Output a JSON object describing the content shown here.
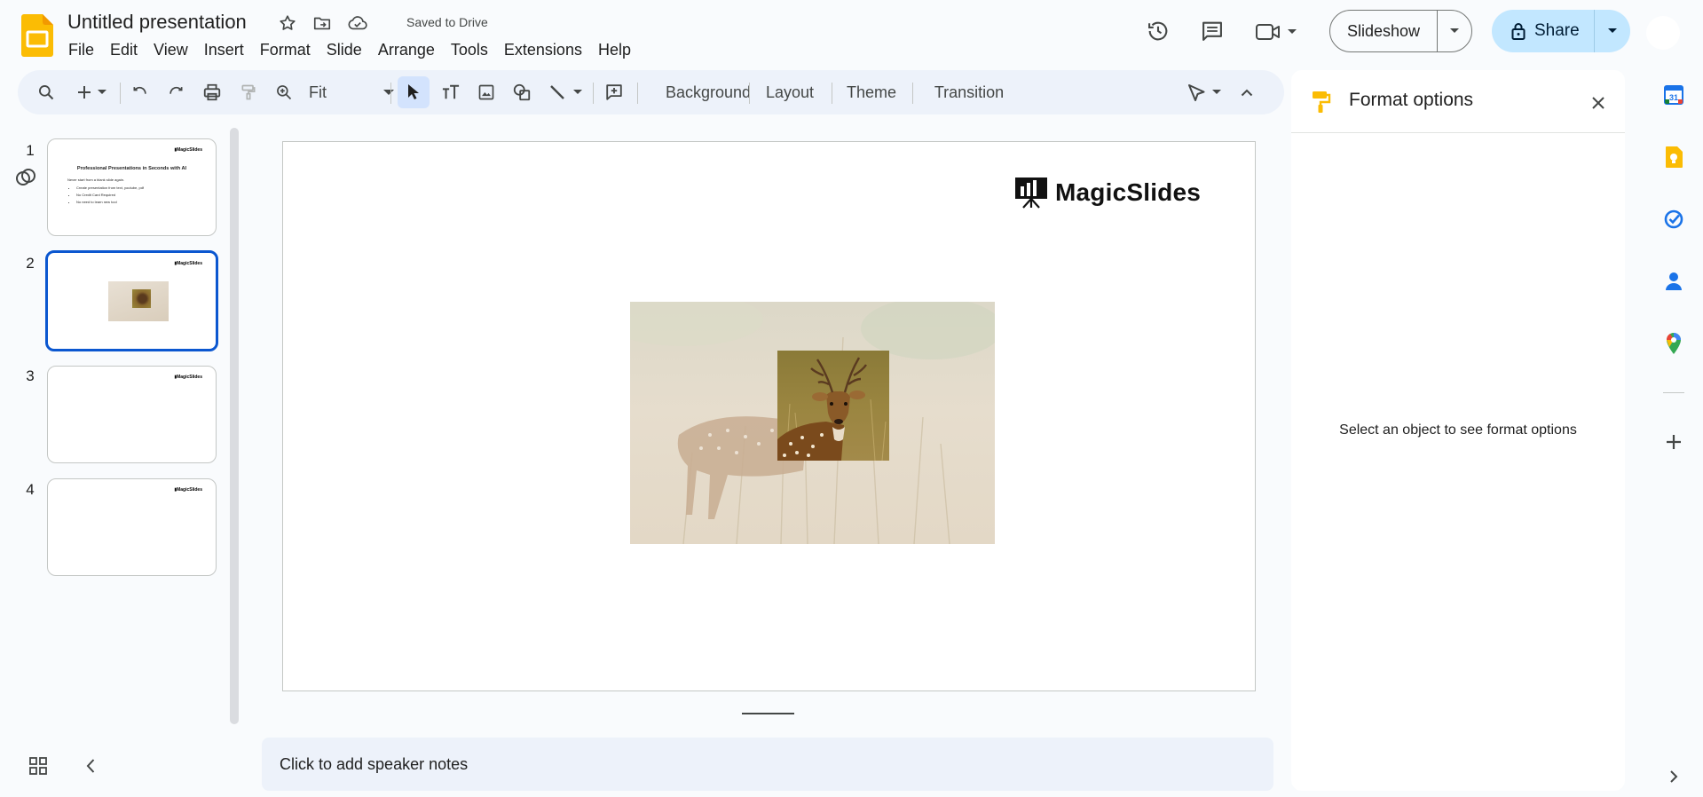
{
  "header": {
    "doc_title": "Untitled presentation",
    "save_status": "Saved to Drive",
    "menu": [
      "File",
      "Edit",
      "View",
      "Insert",
      "Format",
      "Slide",
      "Arrange",
      "Tools",
      "Extensions",
      "Help"
    ],
    "slideshow_label": "Slideshow",
    "share_label": "Share"
  },
  "toolbar": {
    "zoom_label": "Fit",
    "background_label": "Background",
    "layout_label": "Layout",
    "theme_label": "Theme",
    "transition_label": "Transition"
  },
  "filmstrip": {
    "slides": [
      {
        "number": "1",
        "logo": "MagicSlides",
        "title": "Professional Presentations in Seconds with AI",
        "intro": "Never start from a blank slide again.",
        "bullets": [
          "Create presentation from text, youtube, pdf",
          "No Credit Card Required",
          "No need to learn new tool"
        ]
      },
      {
        "number": "2",
        "logo": "MagicSlides",
        "selected": true
      },
      {
        "number": "3",
        "logo": "MagicSlides"
      },
      {
        "number": "4",
        "logo": "MagicSlides"
      }
    ]
  },
  "slide": {
    "brand_name": "MagicSlides"
  },
  "notes": {
    "placeholder": "Click to add speaker notes"
  },
  "format_panel": {
    "title": "Format options",
    "empty_message": "Select an object to see format options"
  },
  "colors": {
    "accent_blue": "#0b57d0",
    "share_bg": "#c2e7ff",
    "toolbar_bg": "#edf2fa",
    "slides_yellow": "#fbbc04"
  }
}
